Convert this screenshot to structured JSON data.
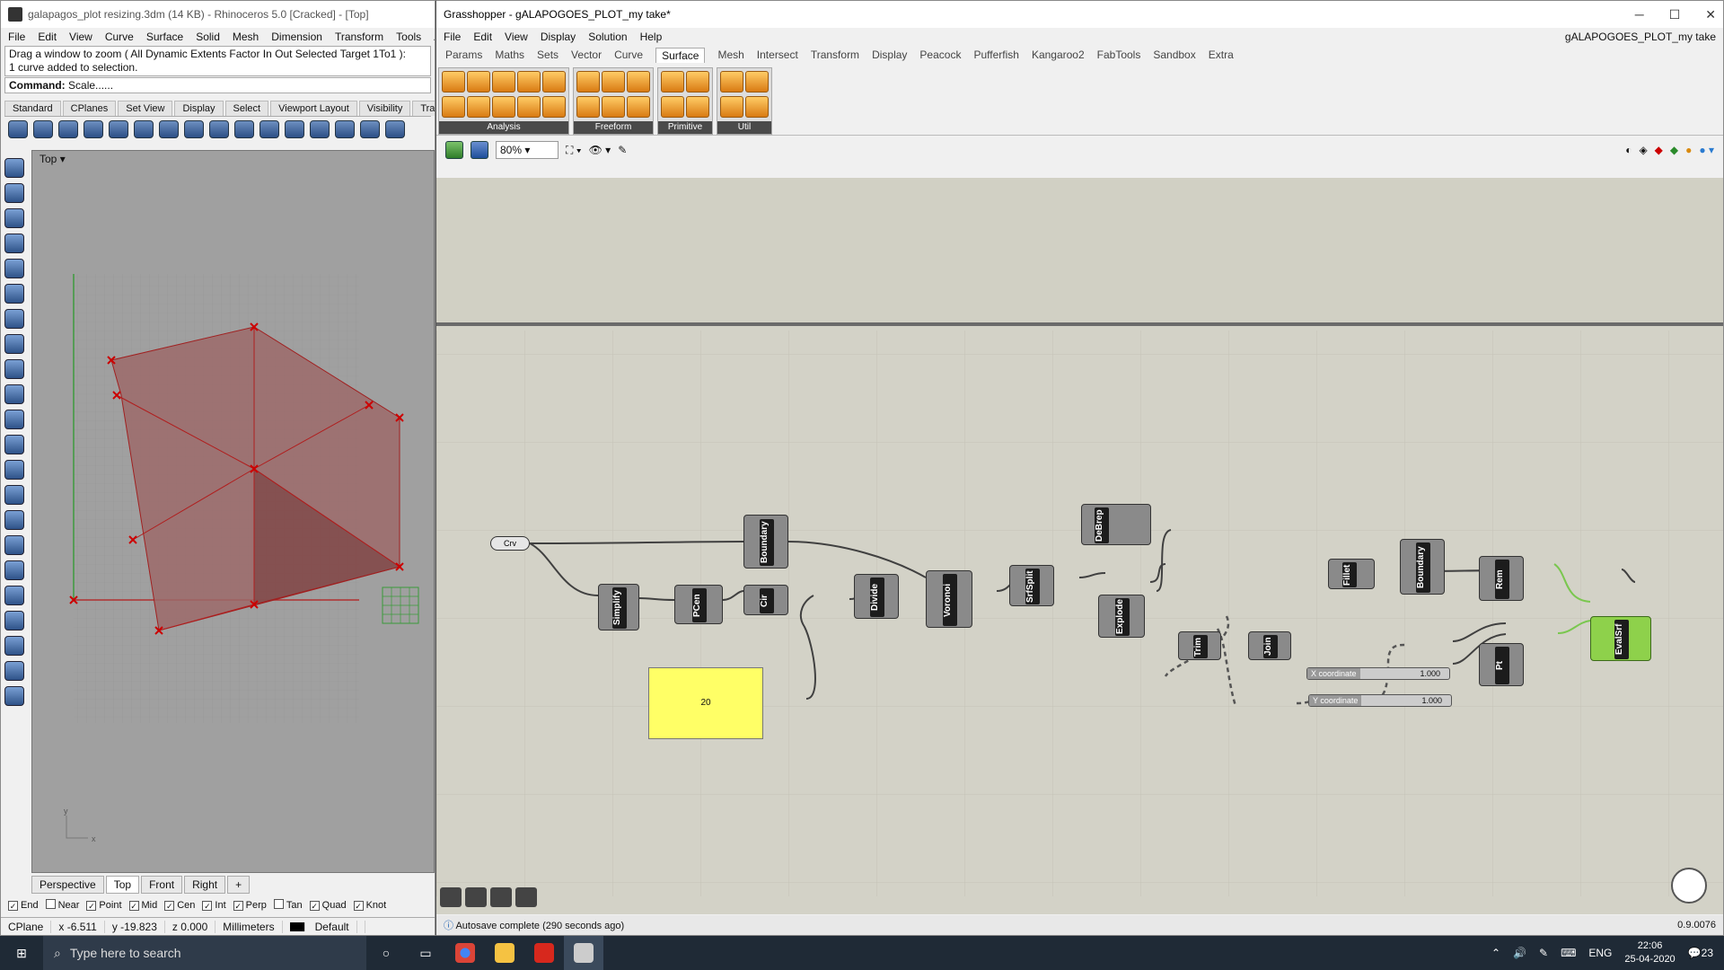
{
  "rhino": {
    "title": "galapagos_plot resizing.3dm (14 KB) - Rhinoceros 5.0 [Cracked] - [Top]",
    "menu": [
      "File",
      "Edit",
      "View",
      "Curve",
      "Surface",
      "Solid",
      "Mesh",
      "Dimension",
      "Transform",
      "Tools",
      "A"
    ],
    "history_line1": "Drag a window to zoom ( All  Dynamic  Extents  Factor  In  Out  Selected  Target  1To1 ):",
    "history_line2": "1 curve added to selection.",
    "command_label": "Command:",
    "command_value": "Scale......",
    "toolbar_tabs": [
      "Standard",
      "CPlanes",
      "Set View",
      "Display",
      "Select",
      "Viewport Layout",
      "Visibility",
      "Transf"
    ],
    "viewport_label": "Top",
    "view_tabs": [
      "Perspective",
      "Top",
      "Front",
      "Right"
    ],
    "view_tab_add": "+",
    "osnaps": [
      {
        "label": "End",
        "checked": true
      },
      {
        "label": "Near",
        "checked": false
      },
      {
        "label": "Point",
        "checked": true
      },
      {
        "label": "Mid",
        "checked": true
      },
      {
        "label": "Cen",
        "checked": true
      },
      {
        "label": "Int",
        "checked": true
      },
      {
        "label": "Perp",
        "checked": true
      },
      {
        "label": "Tan",
        "checked": false
      },
      {
        "label": "Quad",
        "checked": true
      },
      {
        "label": "Knot",
        "checked": true
      }
    ],
    "status": {
      "cplane": "CPlane",
      "x": "x -6.511",
      "y": "y -19.823",
      "z": "z 0.000",
      "units": "Millimeters",
      "layer": "Default"
    },
    "axis_y": "y",
    "axis_x": "x"
  },
  "gh": {
    "title": "Grasshopper - gALAPOGOES_PLOT_my take*",
    "doc_name": "gALAPOGOES_PLOT_my take",
    "menu": [
      "File",
      "Edit",
      "View",
      "Display",
      "Solution",
      "Help"
    ],
    "tabs": [
      "Params",
      "Maths",
      "Sets",
      "Vector",
      "Curve",
      "Surface",
      "Mesh",
      "Intersect",
      "Transform",
      "Display",
      "Peacock",
      "Pufferfish",
      "Kangaroo2",
      "FabTools",
      "Sandbox",
      "Extra"
    ],
    "active_tab": "Surface",
    "groups": [
      "Analysis",
      "Freeform",
      "Primitive",
      "Util"
    ],
    "zoom": "80%",
    "autosave": "Autosave complete (290 seconds ago)",
    "version": "0.9.0076",
    "components": {
      "crv": "Crv",
      "boundary1": "Boundary",
      "simplify": "Simplify",
      "pcen": "PCen",
      "cir": "Cir",
      "divide": "Divide",
      "voronoi": "Voronoi",
      "srfsplit": "SrfSplit",
      "debrep": "DeBrep",
      "explode": "Explode",
      "trim": "Trim",
      "join": "Join",
      "fillet": "Fillet",
      "boundary2": "Boundary",
      "rem": "Rem",
      "pt": "Pt",
      "evalsrf": "EvalSrf"
    },
    "panel_value": "20",
    "slider_x": {
      "label": "X coordinate",
      "value": "1.000"
    },
    "slider_y": {
      "label": "Y coordinate",
      "value": "1.000"
    }
  },
  "taskbar": {
    "search_placeholder": "Type here to search",
    "lang": "ENG",
    "time": "22:06",
    "date": "25-04-2020",
    "notif": "23"
  }
}
